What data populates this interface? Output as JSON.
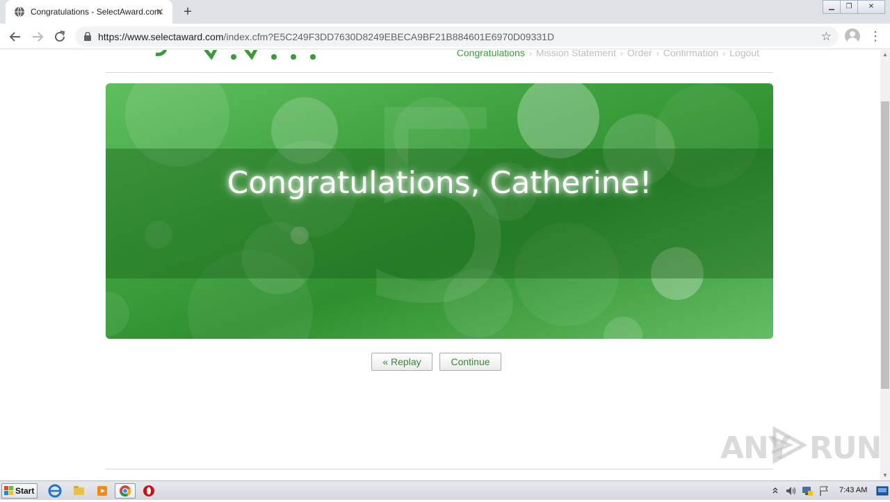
{
  "browser": {
    "tab_title": "Congratulations - SelectAward.com",
    "url_host": "https://www.selectaward.com",
    "url_path": "/index.cfm?E5C249F3DD7630D8249EBECA9BF21B884601E6970D09331D"
  },
  "page": {
    "breadcrumb": {
      "items": [
        "Congratulations",
        "Mission Statement",
        "Order",
        "Confirmation",
        "Logout"
      ],
      "active_index": 0
    },
    "banner": {
      "title": "Congratulations, Catherine!",
      "background_digit": "5"
    },
    "buttons": {
      "replay": "« Replay",
      "continue": "Continue"
    },
    "watermark": {
      "left": "ANY",
      "right": "RUN"
    }
  },
  "taskbar": {
    "start_label": "Start",
    "clock": "7:43 AM"
  },
  "colors": {
    "brand_green": "#3a9a3a",
    "banner_green": "#3ea23e",
    "chrome_gray": "#dee1e6"
  }
}
